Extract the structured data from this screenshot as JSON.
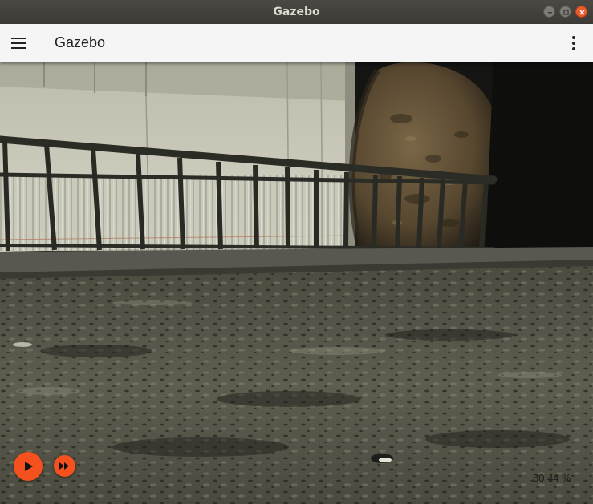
{
  "window": {
    "title": "Gazebo"
  },
  "appbar": {
    "title": "Gazebo",
    "menu_icon": "hamburger-menu-icon",
    "more_icon": "more-vert-icon"
  },
  "playback": {
    "play_icon": "play-icon",
    "step_icon": "fast-forward-icon"
  },
  "status": {
    "real_time_factor": "60.44 %"
  },
  "colors": {
    "accent": "#f4511e",
    "titlebar": "#3b3a36",
    "appbar": "#f5f5f5",
    "close_button": "#ea5a2c"
  }
}
